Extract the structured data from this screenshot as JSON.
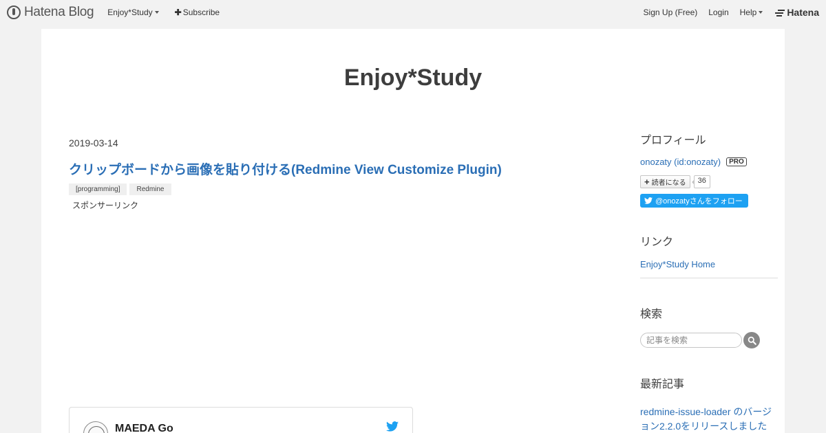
{
  "navbar": {
    "logo_text": "Hatena Blog",
    "blog_menu": "Enjoy*Study",
    "subscribe": "Subscribe",
    "signup": "Sign Up (Free)",
    "login": "Login",
    "help": "Help",
    "hatena": "Hatena"
  },
  "blog": {
    "title": "Enjoy*Study"
  },
  "entry": {
    "date": "2019-03-14",
    "title": "クリップボードから画像を貼り付ける(Redmine View Customize Plugin)",
    "tags": [
      "[programming]",
      "Redmine"
    ],
    "sponsored": "スポンサーリンク"
  },
  "tweet": {
    "name": "MAEDA Go"
  },
  "sidebar": {
    "profile": {
      "heading": "プロフィール",
      "user": "onozaty (id:onozaty)",
      "badge": "PRO",
      "reader_button": "読者になる",
      "reader_count": "36",
      "follow": "@onozatyさんをフォロー"
    },
    "links": {
      "heading": "リンク",
      "home": "Enjoy*Study Home"
    },
    "search": {
      "heading": "検索",
      "placeholder": "記事を検索"
    },
    "recent": {
      "heading": "最新記事",
      "first": "redmine-issue-loader のバージョン2.2.0をリリースしました"
    }
  },
  "colors": {
    "link": "#2a6eb5",
    "twitter": "#1da1f2",
    "background": "#f2f2f2"
  }
}
